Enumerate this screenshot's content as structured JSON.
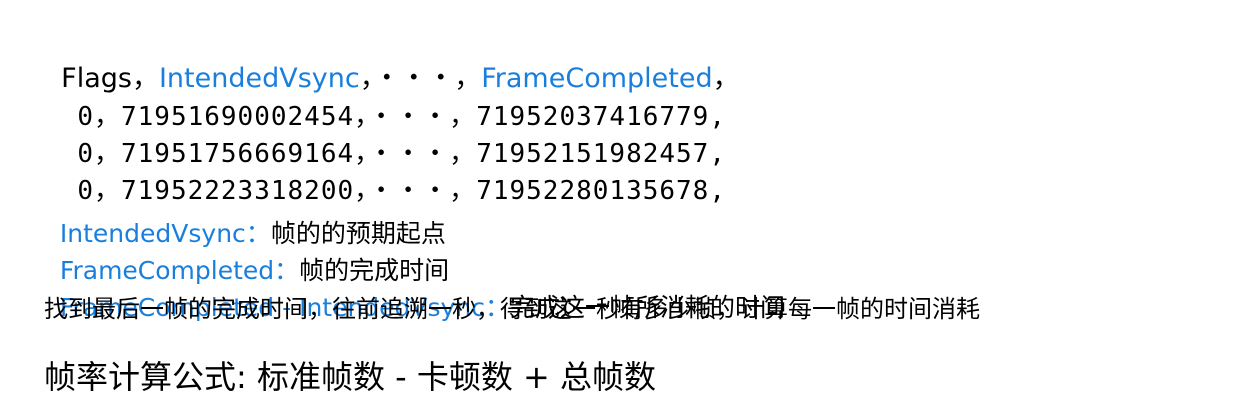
{
  "csv": {
    "header": [
      "Flags",
      "IntendedVsync",
      "・・・",
      "FrameCompleted"
    ],
    "rows": [
      [
        "0",
        "71951690002454",
        "・・・",
        "71952037416779"
      ],
      [
        "0",
        "71951756669164",
        "・・・",
        "71952151982457"
      ],
      [
        "0",
        "71952223318200",
        "・・・",
        "71952280135678"
      ]
    ]
  },
  "definitions": [
    {
      "term": "IntendedVsync",
      "text": "帧的的预期起点"
    },
    {
      "term": "FrameCompleted",
      "text": "帧的完成时间"
    },
    {
      "term": "FrameCompleted - IntendedVsync",
      "text": "完成这一帧所消耗的时间"
    }
  ],
  "method": "找到最后一帧的完成时间，往前追溯一秒，得到这一秒有多少帧，计算每一帧的时间消耗",
  "formula": "帧率计算公式: 标准帧数 - 卡顿数 + 总帧数",
  "colors": {
    "accent": "#1a7fdc",
    "text": "#000000"
  }
}
